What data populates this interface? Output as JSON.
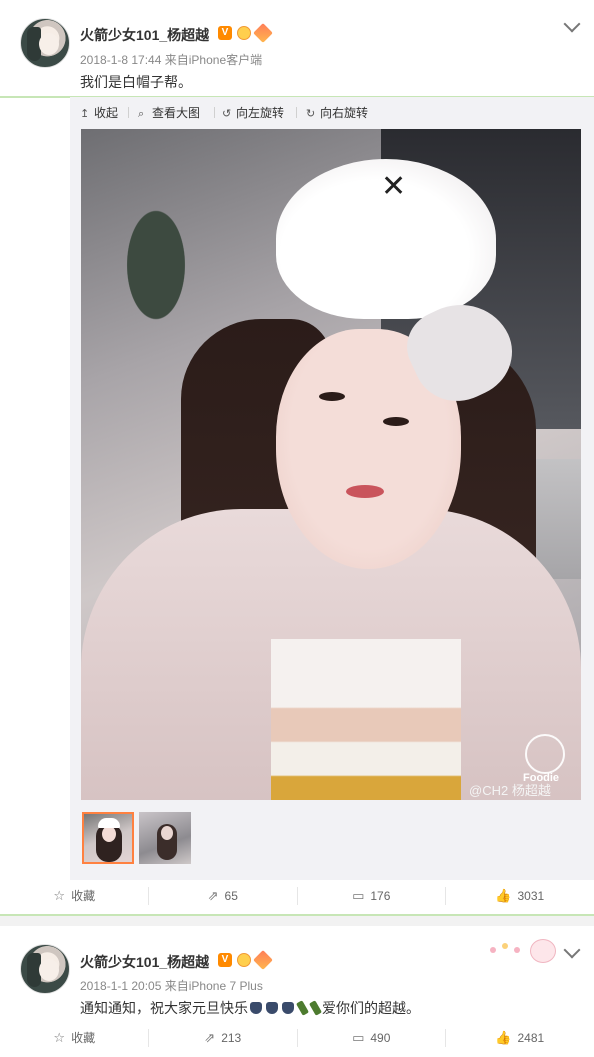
{
  "post1": {
    "username": "火箭少女101_杨超越",
    "verified_badge": "V",
    "date": "2018-1-8 17:44",
    "source_prefix": "来自",
    "source": "iPhone客户端",
    "text": "我们是白帽子帮。",
    "toolbar": {
      "collapse": "收起",
      "view_large": "查看大图",
      "rotate_left": "向左旋转",
      "rotate_right": "向右旋转"
    },
    "watermark": "@CH2 杨超越",
    "watermark_app": "Foodie",
    "actions": {
      "favorite": "收藏",
      "repost_count": "65",
      "comment_count": "176",
      "like_count": "3031"
    }
  },
  "post2": {
    "username": "火箭少女101_杨超越",
    "verified_badge": "V",
    "date": "2018-1-1 20:05",
    "source_prefix": "来自",
    "source": "iPhone 7 Plus",
    "text_before": "通知通知，祝大家元旦快乐",
    "text_after": "爱你们的超越。",
    "actions": {
      "favorite": "收藏",
      "repost_count": "213",
      "comment_count": "490",
      "like_count": "2481"
    }
  },
  "icons": {
    "collapse": "↥",
    "view_large": "⌕",
    "rotate_left": "↺",
    "rotate_right": "↻",
    "favorite": "☆",
    "repost": "⇗",
    "comment": "▭",
    "like": "👍"
  },
  "colors": {
    "accent_orange": "#ff8140",
    "verified_orange": "#ff8a00",
    "divider_green": "#c7e6b6"
  }
}
